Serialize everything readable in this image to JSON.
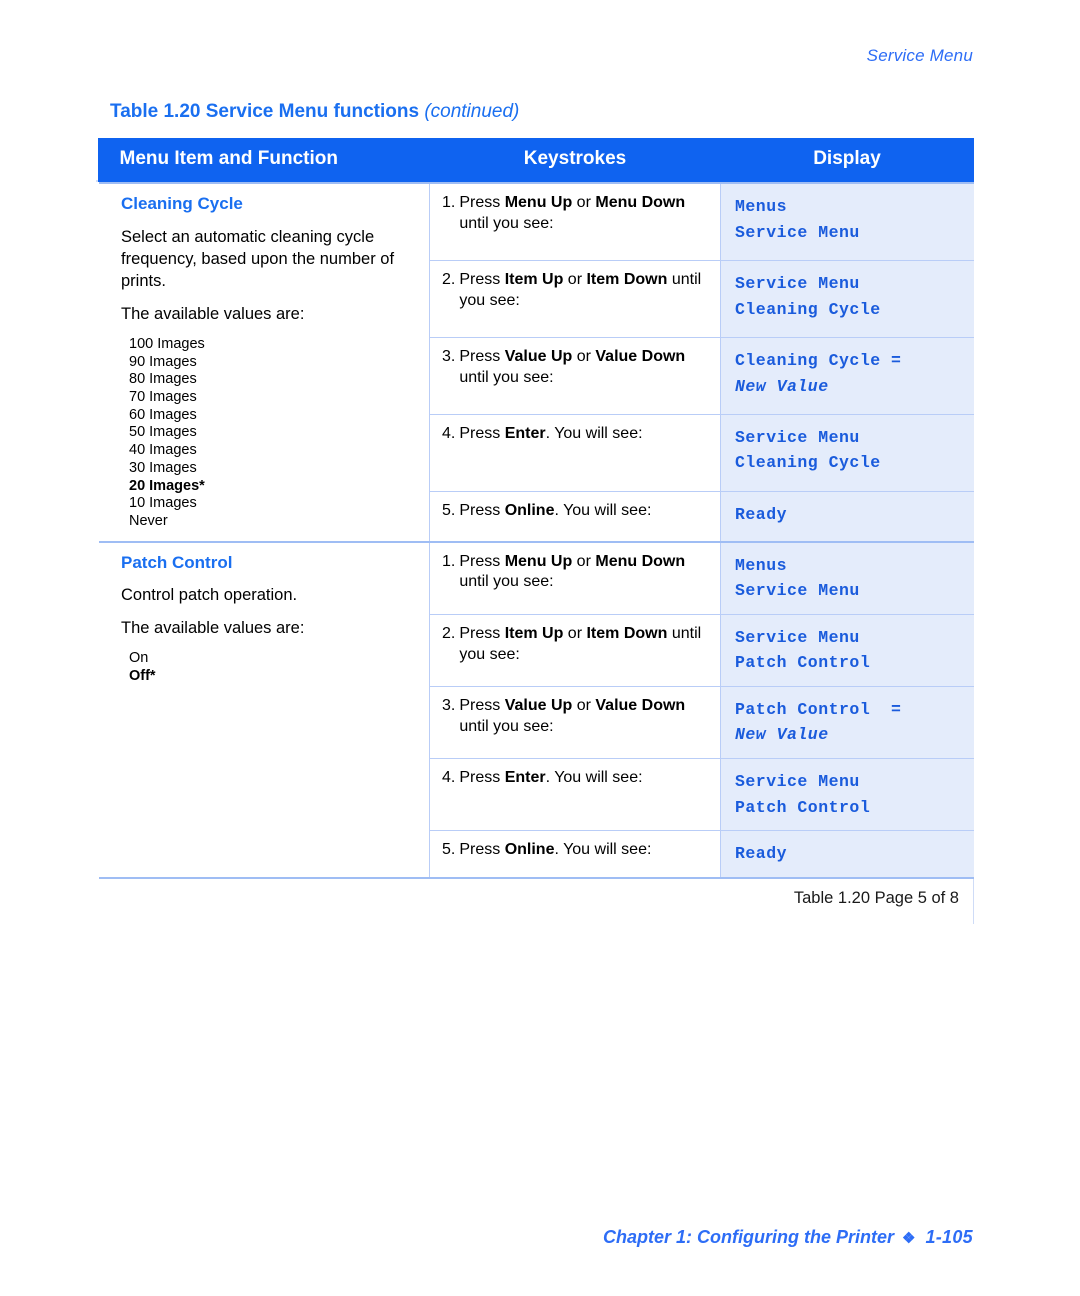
{
  "running_head": "Service Menu",
  "table_title": {
    "main": "Table 1.20  Service Menu functions ",
    "continued": "(continued)"
  },
  "colors": {
    "header_bg": "#0f63f0",
    "accent_blue": "#1a6ff0",
    "display_bg": "#e4ecfb",
    "display_text": "#1a5bdc",
    "rule": "#b9cdf7"
  },
  "header": {
    "col1": "Menu Item and Function",
    "col2": "Keystrokes",
    "col3": "Display"
  },
  "sections": [
    {
      "title": "Cleaning Cycle",
      "description": "Select an automatic cleaning cycle frequency, based upon the number of prints.",
      "values_intro": "The available values are:",
      "values": [
        {
          "text": "100 Images",
          "default": false
        },
        {
          "text": "90 Images",
          "default": false
        },
        {
          "text": "80 Images",
          "default": false
        },
        {
          "text": "70 Images",
          "default": false
        },
        {
          "text": "60 Images",
          "default": false
        },
        {
          "text": "50 Images",
          "default": false
        },
        {
          "text": "40 Images",
          "default": false
        },
        {
          "text": "30 Images",
          "default": false
        },
        {
          "text": "20 Images*",
          "default": true
        },
        {
          "text": "10 Images",
          "default": false
        },
        {
          "text": "Never",
          "default": false
        }
      ],
      "steps": [
        {
          "num": "1.",
          "parts": [
            {
              "t": "Press ",
              "b": false
            },
            {
              "t": "Menu Up",
              "b": true
            },
            {
              "t": " or ",
              "b": false
            },
            {
              "t": "Menu Down",
              "b": true
            },
            {
              "t": " until you see:",
              "b": false
            }
          ],
          "display": "Menus\nService Menu",
          "display_italic_tail": ""
        },
        {
          "num": "2.",
          "parts": [
            {
              "t": "Press ",
              "b": false
            },
            {
              "t": "Item Up",
              "b": true
            },
            {
              "t": " or ",
              "b": false
            },
            {
              "t": "Item Down",
              "b": true
            },
            {
              "t": " until you see:",
              "b": false
            }
          ],
          "display": "Service Menu\nCleaning Cycle",
          "display_italic_tail": ""
        },
        {
          "num": "3.",
          "parts": [
            {
              "t": "Press ",
              "b": false
            },
            {
              "t": "Value Up",
              "b": true
            },
            {
              "t": " or ",
              "b": false
            },
            {
              "t": "Value Down",
              "b": true
            },
            {
              "t": " until you see:",
              "b": false
            }
          ],
          "display": "Cleaning Cycle =\n",
          "display_italic_tail": "New Value"
        },
        {
          "num": "4.",
          "parts": [
            {
              "t": "Press ",
              "b": false
            },
            {
              "t": "Enter",
              "b": true
            },
            {
              "t": ". You will see:",
              "b": false
            }
          ],
          "display": "Service Menu\nCleaning Cycle",
          "display_italic_tail": ""
        },
        {
          "num": "5.",
          "parts": [
            {
              "t": "Press ",
              "b": false
            },
            {
              "t": "Online",
              "b": true
            },
            {
              "t": ". You will see:",
              "b": false
            }
          ],
          "display": "Ready",
          "display_italic_tail": ""
        }
      ]
    },
    {
      "title": "Patch Control",
      "description": "Control patch operation.",
      "values_intro": "The available values are:",
      "values": [
        {
          "text": "On",
          "default": false
        },
        {
          "text": "Off*",
          "default": true
        }
      ],
      "steps": [
        {
          "num": "1.",
          "parts": [
            {
              "t": "Press ",
              "b": false
            },
            {
              "t": "Menu Up",
              "b": true
            },
            {
              "t": " or ",
              "b": false
            },
            {
              "t": "Menu Down",
              "b": true
            },
            {
              "t": " until you see:",
              "b": false
            }
          ],
          "display": "Menus\nService Menu",
          "display_italic_tail": ""
        },
        {
          "num": "2.",
          "parts": [
            {
              "t": "Press ",
              "b": false
            },
            {
              "t": "Item Up",
              "b": true
            },
            {
              "t": " or ",
              "b": false
            },
            {
              "t": "Item Down",
              "b": true
            },
            {
              "t": " until you see:",
              "b": false
            }
          ],
          "display": "Service Menu\nPatch Control",
          "display_italic_tail": ""
        },
        {
          "num": "3.",
          "parts": [
            {
              "t": "Press ",
              "b": false
            },
            {
              "t": "Value Up",
              "b": true
            },
            {
              "t": " or ",
              "b": false
            },
            {
              "t": "Value Down",
              "b": true
            },
            {
              "t": " until you see:",
              "b": false
            }
          ],
          "display": "Patch Control  =\n",
          "display_italic_tail": "New Value"
        },
        {
          "num": "4.",
          "parts": [
            {
              "t": "Press ",
              "b": false
            },
            {
              "t": "Enter",
              "b": true
            },
            {
              "t": ". You will see:",
              "b": false
            }
          ],
          "display": "Service Menu\nPatch Control",
          "display_italic_tail": ""
        },
        {
          "num": "5.",
          "parts": [
            {
              "t": "Press ",
              "b": false
            },
            {
              "t": "Online",
              "b": true
            },
            {
              "t": ". You will see:",
              "b": false
            }
          ],
          "display": "Ready",
          "display_italic_tail": ""
        }
      ]
    }
  ],
  "table_caption": "Table 1.20  Page 5 of 8",
  "footer": {
    "chapter": "Chapter 1: Configuring the Printer",
    "diamond": "❖",
    "page_number": "1-105"
  }
}
